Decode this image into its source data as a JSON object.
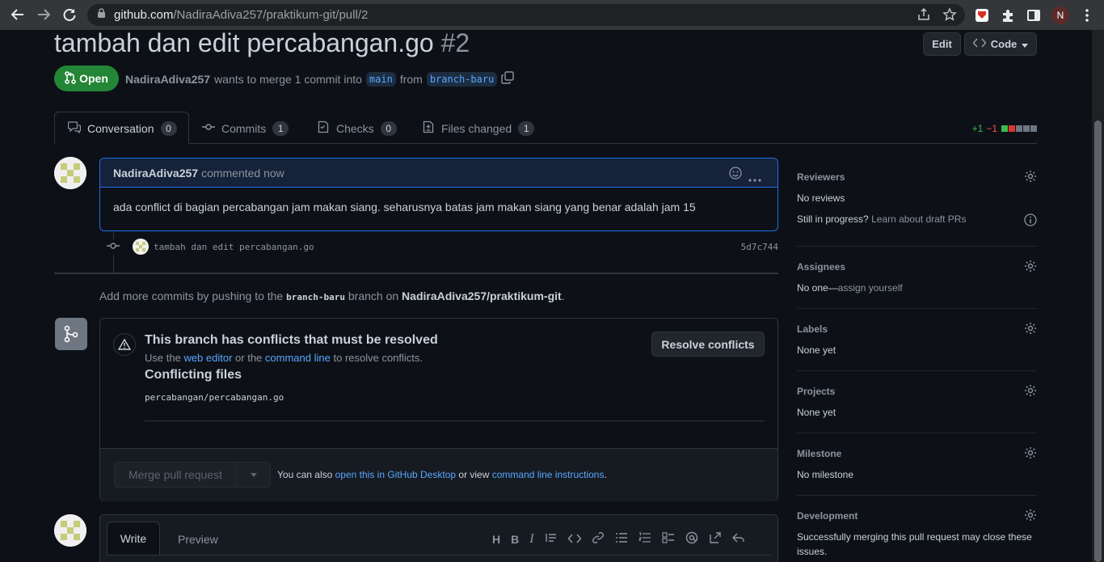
{
  "browser": {
    "url_host": "github.com",
    "url_path": "/NadiraAdiva257/praktikum-git/pull/2",
    "profile_initial": "N"
  },
  "pr": {
    "title": "tambah dan edit percabangan.go",
    "number": "#2",
    "edit_label": "Edit",
    "code_label": "Code",
    "state": "Open",
    "author": "NadiraAdiva257",
    "merge_text": "wants to merge 1 commit into",
    "base_branch": "main",
    "from_text": "from",
    "head_branch": "branch-baru"
  },
  "tabs": [
    {
      "label": "Conversation",
      "count": "0"
    },
    {
      "label": "Commits",
      "count": "1"
    },
    {
      "label": "Checks",
      "count": "0"
    },
    {
      "label": "Files changed",
      "count": "1"
    }
  ],
  "diffstat": {
    "added": "+1",
    "removed": "−1"
  },
  "comment": {
    "author": "NadiraAdiva257",
    "time": "commented now",
    "body": "ada conflict di bagian percabangan jam makan siang. seharusnya batas jam makan siang yang benar adalah jam 15"
  },
  "commit": {
    "message": "tambah dan edit percabangan.go",
    "sha": "5d7c744"
  },
  "push_hint": {
    "prefix": "Add more commits by pushing to the",
    "branch": "branch-baru",
    "middle": "branch on",
    "repo": "NadiraAdiva257/praktikum-git",
    "suffix": "."
  },
  "merge": {
    "conflict_title": "This branch has conflicts that must be resolved",
    "use_text": "Use the",
    "web_editor": "web editor",
    "or_text": "or the",
    "command_line": "command line",
    "resolve_text": "to resolve conflicts.",
    "resolve_button": "Resolve conflicts",
    "conflicting_title": "Conflicting files",
    "conflicting_file": "percabangan/percabangan.go",
    "merge_button": "Merge pull request",
    "also_text": "You can also",
    "desktop_link": "open this in GitHub Desktop",
    "or_view": "or view",
    "cli_link": "command line instructions",
    "period": "."
  },
  "sidebar": {
    "reviewers": {
      "title": "Reviewers",
      "value": "No reviews",
      "progress": "Still in progress?",
      "draft_link": "Learn about draft PRs"
    },
    "assignees": {
      "title": "Assignees",
      "value": "No one—",
      "assign_link": "assign yourself"
    },
    "labels": {
      "title": "Labels",
      "value": "None yet"
    },
    "projects": {
      "title": "Projects",
      "value": "None yet"
    },
    "milestone": {
      "title": "Milestone",
      "value": "No milestone"
    },
    "development": {
      "title": "Development",
      "value": "Successfully merging this pull request may close these issues."
    }
  },
  "composer": {
    "write_tab": "Write",
    "preview_tab": "Preview"
  },
  "colors": {
    "accent": "#58a6ff",
    "open_green": "#238636",
    "bg": "#0d1117",
    "border": "#30363d"
  }
}
